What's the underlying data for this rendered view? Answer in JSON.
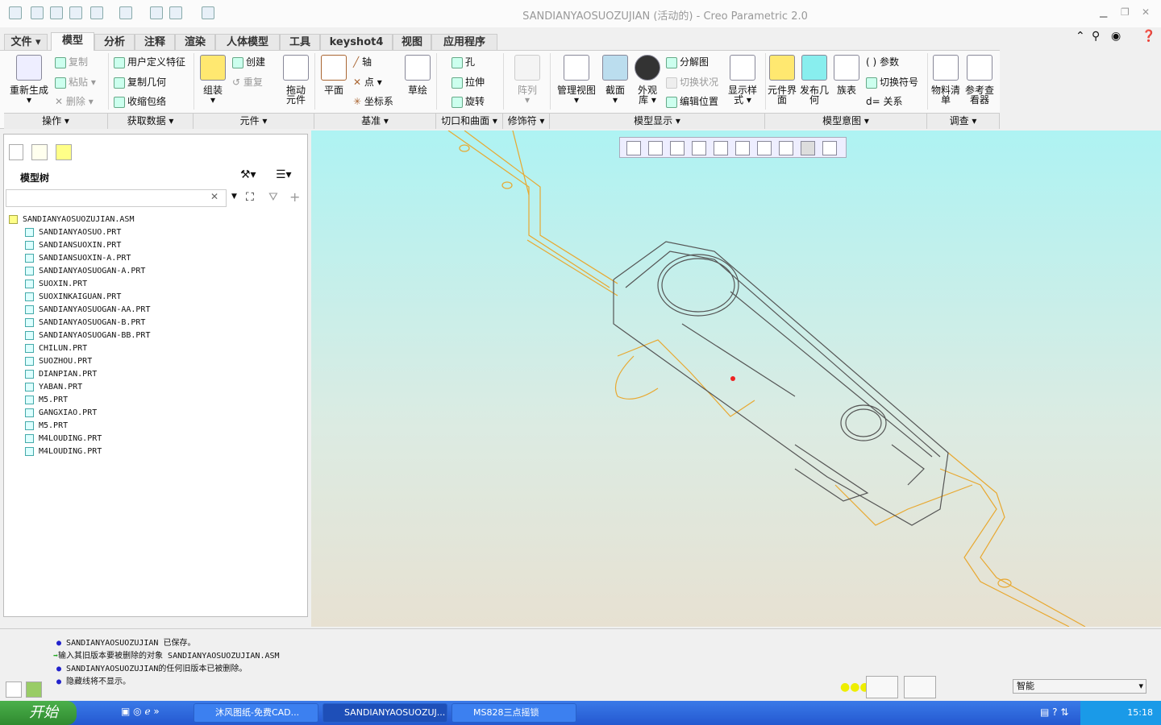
{
  "window": {
    "title": "SANDIANYAOSUOZUJIAN (活动的) - Creo Parametric 2.0"
  },
  "tabs": [
    {
      "label": "文件 ▾"
    },
    {
      "label": "模型"
    },
    {
      "label": "分析"
    },
    {
      "label": "注释"
    },
    {
      "label": "渲染"
    },
    {
      "label": "人体模型"
    },
    {
      "label": "工具"
    },
    {
      "label": "keyshot4"
    },
    {
      "label": "视图"
    },
    {
      "label": "应用程序"
    }
  ],
  "ribbon": {
    "regen": "重新生成",
    "copy": "复制",
    "paste": "粘贴",
    "delete": "删除",
    "udf": "用户定义特征",
    "copygeom": "复制几何",
    "shrinkwrap": "收缩包络",
    "assemble": "组装",
    "create": "创建",
    "repeat": "重复",
    "drag": "拖动元件",
    "plane": "平面",
    "axis": "轴",
    "point": "点",
    "csys": "坐标系",
    "sketch": "草绘",
    "hole": "孔",
    "extrude": "拉伸",
    "revolve": "旋转",
    "pattern": "阵列",
    "manageviews": "管理视图",
    "section": "截面",
    "appearance": "外观库",
    "explode": "分解图",
    "togglestate": "切换状况",
    "editpos": "编辑位置",
    "displaystyle": "显示样式",
    "compinterface": "元件界面",
    "pubgeom": "发布几何",
    "familytable": "族表",
    "params": "参数",
    "switchsym": "切换符号",
    "relations": "关系",
    "bom": "物料清单",
    "refviewer": "参考查看器"
  },
  "groups": [
    {
      "label": "操作 ▾"
    },
    {
      "label": "获取数据 ▾"
    },
    {
      "label": "元件 ▾"
    },
    {
      "label": "基准 ▾"
    },
    {
      "label": "切口和曲面 ▾"
    },
    {
      "label": "修饰符 ▾"
    },
    {
      "label": "模型显示 ▾"
    },
    {
      "label": "模型意图 ▾"
    },
    {
      "label": "调查 ▾"
    }
  ],
  "tree": {
    "title": "模型树",
    "search_value": "",
    "root": "SANDIANYAOSUOZUJIAN.ASM",
    "items": [
      "SANDIANYAOSUO.PRT",
      "SANDIANSUOXIN.PRT",
      "SANDIANSUOXIN-A.PRT",
      "SANDIANYAOSUOGAN-A.PRT",
      "SUOXIN.PRT",
      "SUOXINKAIGUAN.PRT",
      "SANDIANYAOSUOGAN-AA.PRT",
      "SANDIANYAOSUOGAN-B.PRT",
      "SANDIANYAOSUOGAN-BB.PRT",
      "CHILUN.PRT",
      "SUOZHOU.PRT",
      "DIANPIAN.PRT",
      "YABAN.PRT",
      "M5.PRT",
      "GANGXIAO.PRT",
      "M5.PRT",
      "M4LOUDING.PRT",
      "M4LOUDING.PRT"
    ]
  },
  "messages": [
    "SANDIANYAOSUOZUJIAN 已保存。",
    "输入其旧版本要被删除的对象    SANDIANYAOSUOZUJIAN.ASM",
    "SANDIANYAOSUOZUJIAN的任何旧版本已被删除。",
    " 隐藏线将不显示。"
  ],
  "filter": {
    "value": "智能"
  },
  "taskbar": {
    "start": "开始",
    "tasks": [
      "沐风图纸-免费CAD...",
      "SANDIANYAOSUOZUJ...",
      "MS828三点摇锁"
    ],
    "clock": "15:18"
  },
  "colors": {
    "edge_highlight": "#e8a830",
    "edge": "#555555"
  }
}
